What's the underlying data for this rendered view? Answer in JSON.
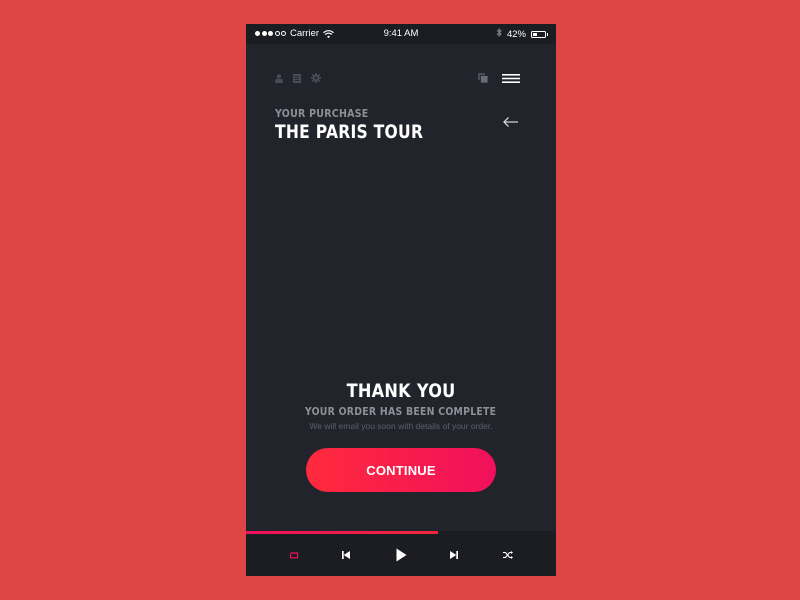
{
  "status_bar": {
    "signal_full": 3,
    "signal_total": 5,
    "carrier": "Carrier",
    "time": "9:41 AM",
    "battery": "42%",
    "battery_level": 0.42
  },
  "nav": {
    "left_icons": [
      "user-icon",
      "document-icon",
      "gear-icon"
    ],
    "right_icons": [
      "copy-icon",
      "menu-icon"
    ]
  },
  "header": {
    "eyebrow": "YOUR PURCHASE",
    "title": "THE PARIS TOUR",
    "back_icon": "arrow-left-icon"
  },
  "confirmation": {
    "title": "THANK YOU",
    "subtitle": "YOUR ORDER HAS BEEN COMPLETE",
    "note": "We will email you soon with details of your order."
  },
  "cta": {
    "label": "CONTINUE"
  },
  "player": {
    "progress": 0.62,
    "controls": [
      "repeat-icon",
      "previous-icon",
      "play-icon",
      "next-icon",
      "shuffle-icon"
    ],
    "active_control": "repeat-icon"
  },
  "colors": {
    "background": "#e04545",
    "phone": "#22242c",
    "bar": "#1c1d23",
    "accent_start": "#ff2a3c",
    "accent_end": "#f0105c",
    "muted_text": "#8e9098"
  }
}
